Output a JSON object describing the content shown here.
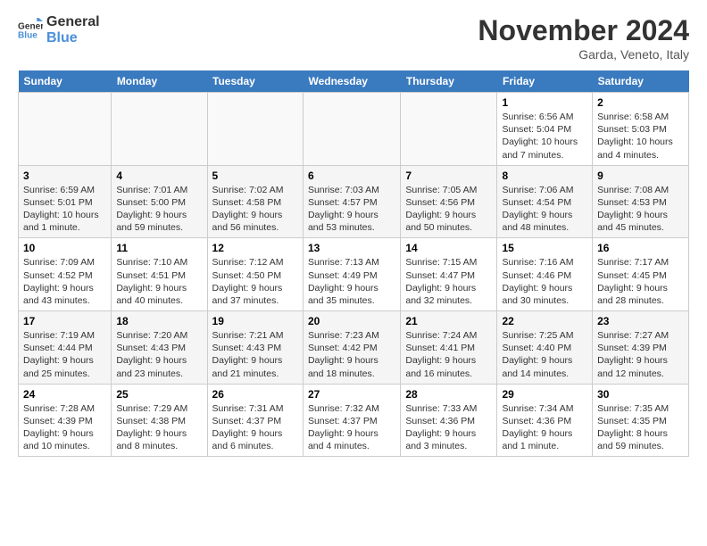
{
  "header": {
    "logo_line1": "General",
    "logo_line2": "Blue",
    "month_title": "November 2024",
    "location": "Garda, Veneto, Italy"
  },
  "days_of_week": [
    "Sunday",
    "Monday",
    "Tuesday",
    "Wednesday",
    "Thursday",
    "Friday",
    "Saturday"
  ],
  "weeks": [
    [
      {
        "day": "",
        "info": ""
      },
      {
        "day": "",
        "info": ""
      },
      {
        "day": "",
        "info": ""
      },
      {
        "day": "",
        "info": ""
      },
      {
        "day": "",
        "info": ""
      },
      {
        "day": "1",
        "info": "Sunrise: 6:56 AM\nSunset: 5:04 PM\nDaylight: 10 hours and 7 minutes."
      },
      {
        "day": "2",
        "info": "Sunrise: 6:58 AM\nSunset: 5:03 PM\nDaylight: 10 hours and 4 minutes."
      }
    ],
    [
      {
        "day": "3",
        "info": "Sunrise: 6:59 AM\nSunset: 5:01 PM\nDaylight: 10 hours and 1 minute."
      },
      {
        "day": "4",
        "info": "Sunrise: 7:01 AM\nSunset: 5:00 PM\nDaylight: 9 hours and 59 minutes."
      },
      {
        "day": "5",
        "info": "Sunrise: 7:02 AM\nSunset: 4:58 PM\nDaylight: 9 hours and 56 minutes."
      },
      {
        "day": "6",
        "info": "Sunrise: 7:03 AM\nSunset: 4:57 PM\nDaylight: 9 hours and 53 minutes."
      },
      {
        "day": "7",
        "info": "Sunrise: 7:05 AM\nSunset: 4:56 PM\nDaylight: 9 hours and 50 minutes."
      },
      {
        "day": "8",
        "info": "Sunrise: 7:06 AM\nSunset: 4:54 PM\nDaylight: 9 hours and 48 minutes."
      },
      {
        "day": "9",
        "info": "Sunrise: 7:08 AM\nSunset: 4:53 PM\nDaylight: 9 hours and 45 minutes."
      }
    ],
    [
      {
        "day": "10",
        "info": "Sunrise: 7:09 AM\nSunset: 4:52 PM\nDaylight: 9 hours and 43 minutes."
      },
      {
        "day": "11",
        "info": "Sunrise: 7:10 AM\nSunset: 4:51 PM\nDaylight: 9 hours and 40 minutes."
      },
      {
        "day": "12",
        "info": "Sunrise: 7:12 AM\nSunset: 4:50 PM\nDaylight: 9 hours and 37 minutes."
      },
      {
        "day": "13",
        "info": "Sunrise: 7:13 AM\nSunset: 4:49 PM\nDaylight: 9 hours and 35 minutes."
      },
      {
        "day": "14",
        "info": "Sunrise: 7:15 AM\nSunset: 4:47 PM\nDaylight: 9 hours and 32 minutes."
      },
      {
        "day": "15",
        "info": "Sunrise: 7:16 AM\nSunset: 4:46 PM\nDaylight: 9 hours and 30 minutes."
      },
      {
        "day": "16",
        "info": "Sunrise: 7:17 AM\nSunset: 4:45 PM\nDaylight: 9 hours and 28 minutes."
      }
    ],
    [
      {
        "day": "17",
        "info": "Sunrise: 7:19 AM\nSunset: 4:44 PM\nDaylight: 9 hours and 25 minutes."
      },
      {
        "day": "18",
        "info": "Sunrise: 7:20 AM\nSunset: 4:43 PM\nDaylight: 9 hours and 23 minutes."
      },
      {
        "day": "19",
        "info": "Sunrise: 7:21 AM\nSunset: 4:43 PM\nDaylight: 9 hours and 21 minutes."
      },
      {
        "day": "20",
        "info": "Sunrise: 7:23 AM\nSunset: 4:42 PM\nDaylight: 9 hours and 18 minutes."
      },
      {
        "day": "21",
        "info": "Sunrise: 7:24 AM\nSunset: 4:41 PM\nDaylight: 9 hours and 16 minutes."
      },
      {
        "day": "22",
        "info": "Sunrise: 7:25 AM\nSunset: 4:40 PM\nDaylight: 9 hours and 14 minutes."
      },
      {
        "day": "23",
        "info": "Sunrise: 7:27 AM\nSunset: 4:39 PM\nDaylight: 9 hours and 12 minutes."
      }
    ],
    [
      {
        "day": "24",
        "info": "Sunrise: 7:28 AM\nSunset: 4:39 PM\nDaylight: 9 hours and 10 minutes."
      },
      {
        "day": "25",
        "info": "Sunrise: 7:29 AM\nSunset: 4:38 PM\nDaylight: 9 hours and 8 minutes."
      },
      {
        "day": "26",
        "info": "Sunrise: 7:31 AM\nSunset: 4:37 PM\nDaylight: 9 hours and 6 minutes."
      },
      {
        "day": "27",
        "info": "Sunrise: 7:32 AM\nSunset: 4:37 PM\nDaylight: 9 hours and 4 minutes."
      },
      {
        "day": "28",
        "info": "Sunrise: 7:33 AM\nSunset: 4:36 PM\nDaylight: 9 hours and 3 minutes."
      },
      {
        "day": "29",
        "info": "Sunrise: 7:34 AM\nSunset: 4:36 PM\nDaylight: 9 hours and 1 minute."
      },
      {
        "day": "30",
        "info": "Sunrise: 7:35 AM\nSunset: 4:35 PM\nDaylight: 8 hours and 59 minutes."
      }
    ]
  ]
}
